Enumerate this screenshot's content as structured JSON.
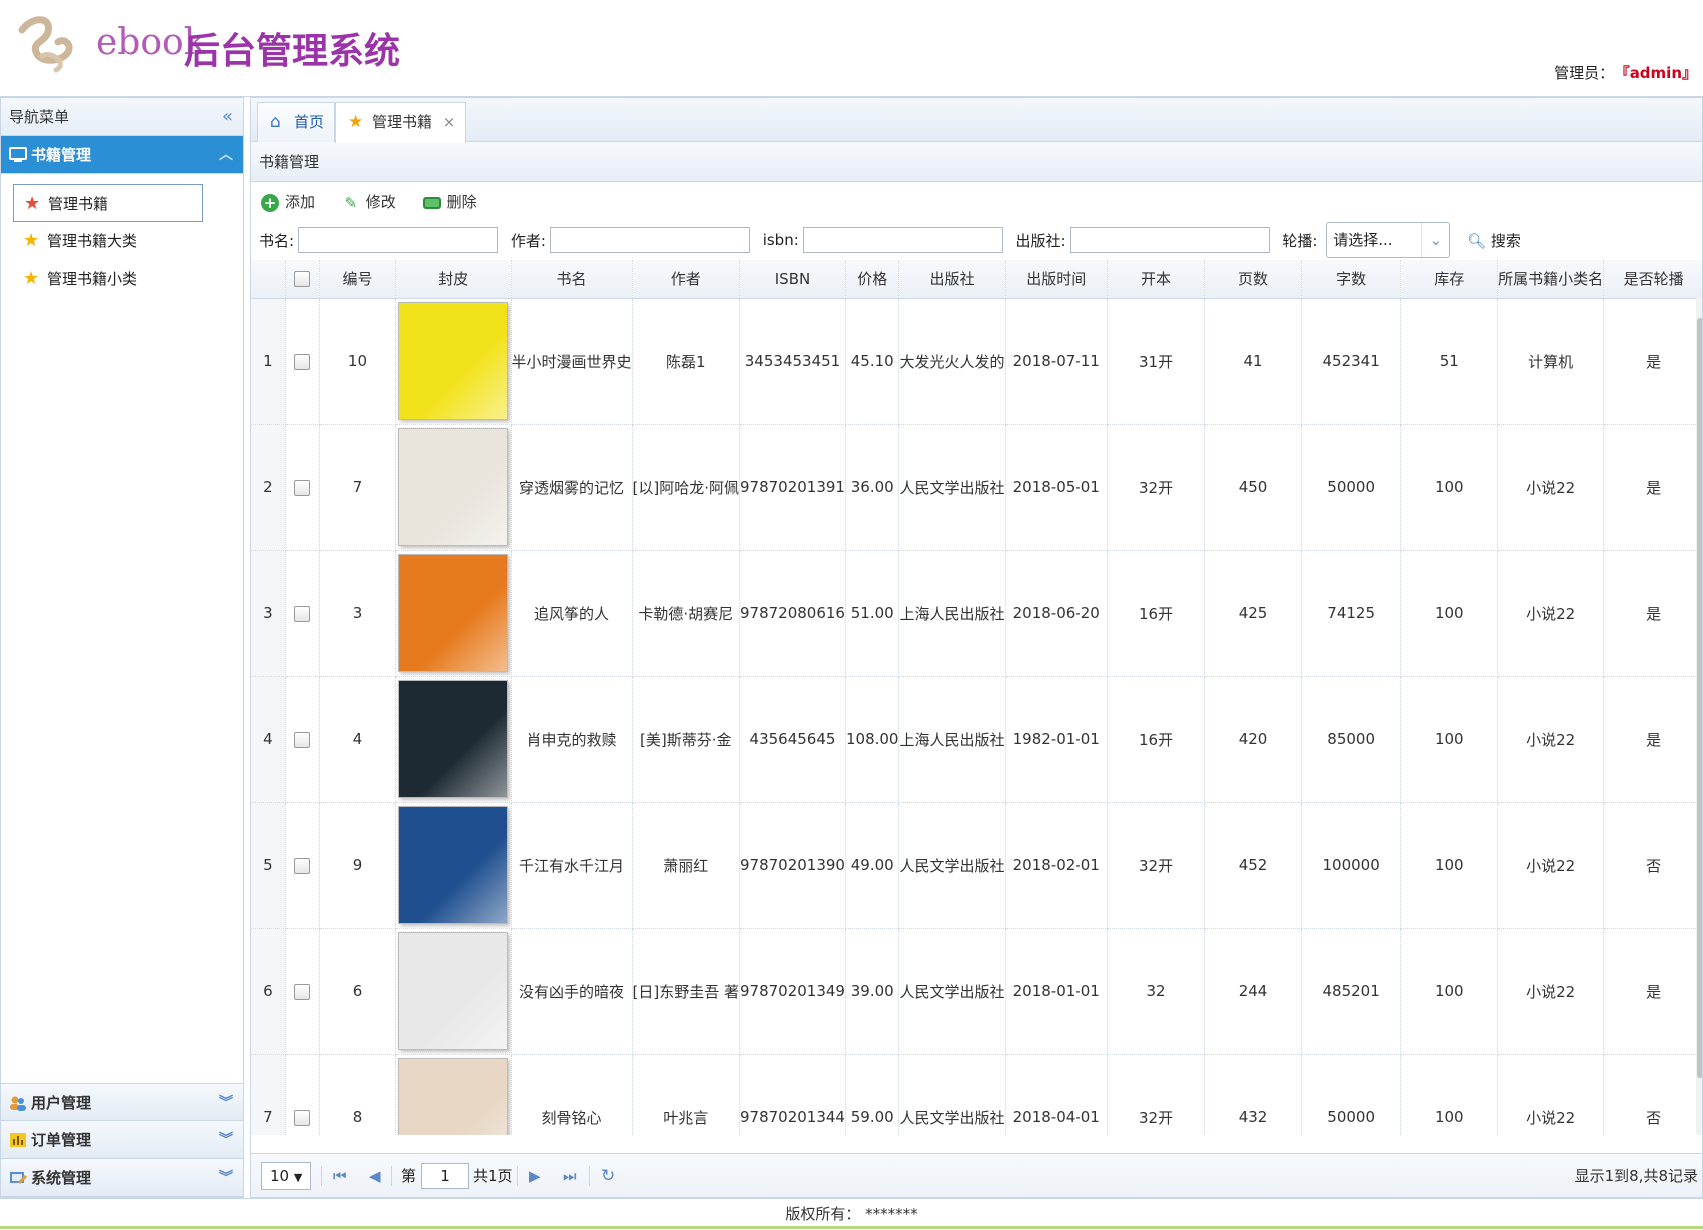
{
  "header": {
    "brand_prefix": "ebook",
    "brand_title": "后台管理系统",
    "admin_label": "管理员：",
    "admin_name": "『admin』"
  },
  "sidebar": {
    "title": "导航菜单",
    "sections": [
      {
        "label": "书籍管理",
        "expanded": true
      },
      {
        "label": "用户管理",
        "expanded": false
      },
      {
        "label": "订单管理",
        "expanded": false
      },
      {
        "label": "系统管理",
        "expanded": false
      }
    ],
    "book_items": [
      "管理书籍",
      "管理书籍大类",
      "管理书籍小类"
    ]
  },
  "tabs": [
    {
      "label": "首页",
      "icon": "home-icon"
    },
    {
      "label": "管理书籍",
      "icon": "star-icon",
      "closable": true
    }
  ],
  "panel": {
    "title": "书籍管理"
  },
  "toolbar": {
    "add": "添加",
    "edit": "修改",
    "delete": "删除"
  },
  "search": {
    "name_label": "书名:",
    "author_label": "作者:",
    "isbn_label": "isbn:",
    "publisher_label": "出版社:",
    "carousel_label": "轮播:",
    "carousel_value": "请选择...",
    "search_button": "搜索"
  },
  "table": {
    "columns": [
      "编号",
      "封皮",
      "书名",
      "作者",
      "ISBN",
      "价格",
      "出版社",
      "出版时间",
      "开本",
      "页数",
      "字数",
      "库存",
      "所属书籍小类名",
      "是否轮播"
    ],
    "rows": [
      {
        "rownum": "1",
        "id": "10",
        "name": "半小时漫画世界史",
        "author": "陈磊1",
        "isbn": "3453453451",
        "price": "45.10",
        "publisher": "大发光火人发的",
        "pubdate": "2018-07-11",
        "format": "31开",
        "pages": "41",
        "words": "452341",
        "stock": "51",
        "category": "计算机",
        "carousel": "是",
        "cover_color": "#f2e21c",
        "cover_title": "半小时漫画世界史"
      },
      {
        "rownum": "2",
        "id": "7",
        "name": "穿透烟雾的记忆",
        "author": "[以]阿哈龙·阿佩",
        "isbn": "97870201391",
        "price": "36.00",
        "publisher": "人民文学出版社",
        "pubdate": "2018-05-01",
        "format": "32开",
        "pages": "450",
        "words": "50000",
        "stock": "100",
        "category": "小说22",
        "carousel": "是",
        "cover_color": "#e9e4dc",
        "cover_title": ""
      },
      {
        "rownum": "3",
        "id": "3",
        "name": "追风筝的人",
        "author": "卡勒德·胡赛尼",
        "isbn": "97872080616",
        "price": "51.00",
        "publisher": "上海人民出版社",
        "pubdate": "2018-06-20",
        "format": "16开",
        "pages": "425",
        "words": "74125",
        "stock": "100",
        "category": "小说22",
        "carousel": "是",
        "cover_color": "#e67a1e",
        "cover_title": ""
      },
      {
        "rownum": "4",
        "id": "4",
        "name": "肖申克的救赎",
        "author": "[美]斯蒂芬·金",
        "isbn": "435645645",
        "price": "108.00",
        "publisher": "上海人民出版社",
        "pubdate": "1982-01-01",
        "format": "16开",
        "pages": "420",
        "words": "85000",
        "stock": "100",
        "category": "小说22",
        "carousel": "是",
        "cover_color": "#1d2a33",
        "cover_title": ""
      },
      {
        "rownum": "5",
        "id": "9",
        "name": "千江有水千江月",
        "author": "萧丽红",
        "isbn": "97870201390",
        "price": "49.00",
        "publisher": "人民文学出版社",
        "pubdate": "2018-02-01",
        "format": "32开",
        "pages": "452",
        "words": "100000",
        "stock": "100",
        "category": "小说22",
        "carousel": "否",
        "cover_color": "#1f4f8f",
        "cover_title": ""
      },
      {
        "rownum": "6",
        "id": "6",
        "name": "没有凶手的暗夜",
        "author": "[日]东野圭吾 著",
        "isbn": "97870201349",
        "price": "39.00",
        "publisher": "人民文学出版社",
        "pubdate": "2018-01-01",
        "format": "32",
        "pages": "244",
        "words": "485201",
        "stock": "100",
        "category": "小说22",
        "carousel": "是",
        "cover_color": "#e8e8e8",
        "cover_title": ""
      },
      {
        "rownum": "7",
        "id": "8",
        "name": "刻骨铭心",
        "author": "叶兆言",
        "isbn": "97870201344",
        "price": "59.00",
        "publisher": "人民文学出版社",
        "pubdate": "2018-04-01",
        "format": "32开",
        "pages": "432",
        "words": "50000",
        "stock": "100",
        "category": "小说22",
        "carousel": "否",
        "cover_color": "#e7d7c4",
        "cover_title": ""
      }
    ]
  },
  "pager": {
    "page_size": "10",
    "page_label_before": "第",
    "page_value": "1",
    "page_label_after": "共1页",
    "info": "显示1到8,共8记录"
  },
  "footer": {
    "copyright": "版权所有： *******"
  },
  "colors": {
    "brand": "#9b34a8",
    "active_section": "#2a8fd4",
    "admin_name": "#d0021b"
  }
}
